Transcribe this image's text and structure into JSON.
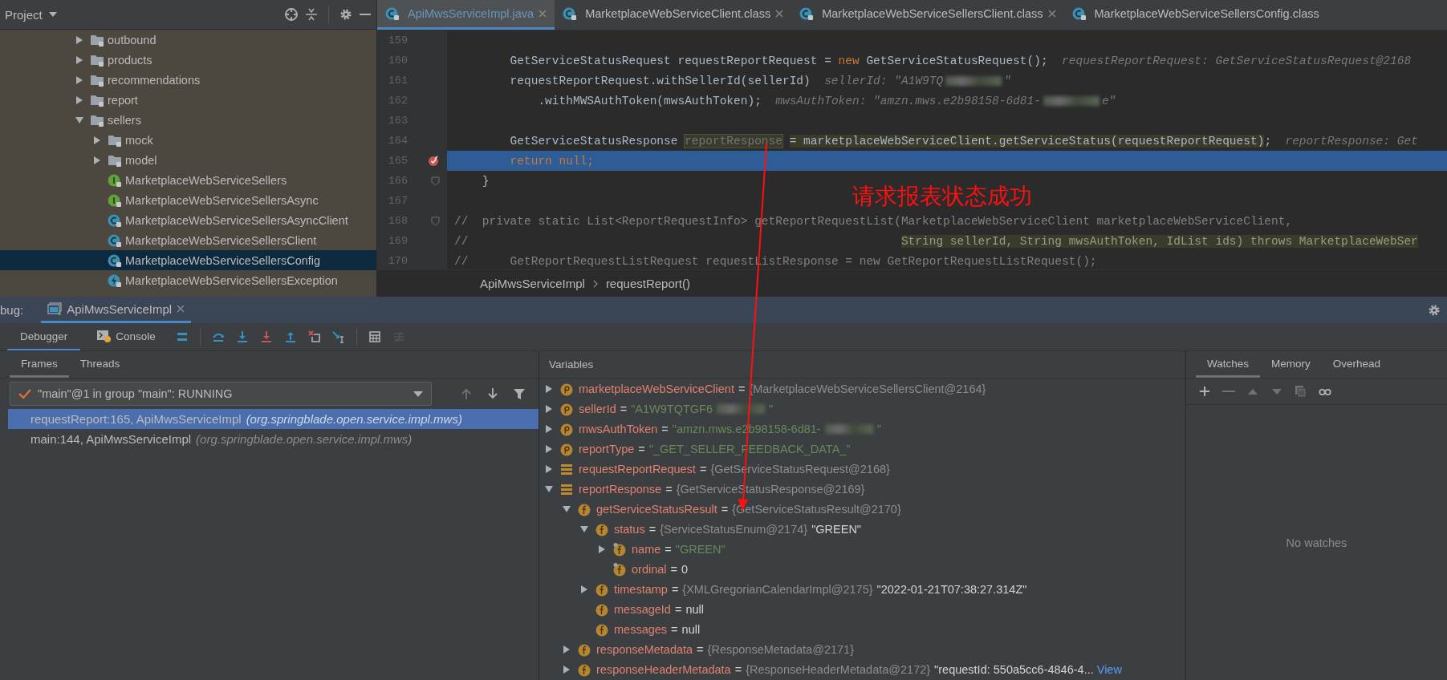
{
  "project": {
    "title": "Project",
    "tree": [
      {
        "label": "outbound",
        "kind": "folder",
        "expanded": false,
        "selected": false
      },
      {
        "label": "products",
        "kind": "folder",
        "expanded": false,
        "selected": false
      },
      {
        "label": "recommendations",
        "kind": "folder",
        "expanded": false,
        "selected": false
      },
      {
        "label": "report",
        "kind": "folder",
        "expanded": false,
        "selected": false
      },
      {
        "label": "sellers",
        "kind": "folder",
        "expanded": true,
        "selected": false,
        "children": [
          {
            "label": "mock",
            "kind": "folder",
            "expanded": false,
            "selected": false
          },
          {
            "label": "model",
            "kind": "folder",
            "expanded": false,
            "selected": false
          },
          {
            "label": "MarketplaceWebServiceSellers",
            "kind": "interface",
            "selected": false
          },
          {
            "label": "MarketplaceWebServiceSellersAsync",
            "kind": "interface",
            "selected": false
          },
          {
            "label": "MarketplaceWebServiceSellersAsyncClient",
            "kind": "class",
            "selected": false
          },
          {
            "label": "MarketplaceWebServiceSellersClient",
            "kind": "class",
            "selected": false
          },
          {
            "label": "MarketplaceWebServiceSellersConfig",
            "kind": "class",
            "selected": true
          },
          {
            "label": "MarketplaceWebServiceSellersException",
            "kind": "exception",
            "selected": false
          }
        ]
      }
    ]
  },
  "editor": {
    "tabs": [
      {
        "label": "ApiMwsServiceImpl.java",
        "selected": true,
        "closable": true
      },
      {
        "label": "MarketplaceWebServiceClient.class",
        "selected": false,
        "closable": true
      },
      {
        "label": "MarketplaceWebServiceSellersClient.class",
        "selected": false,
        "closable": true
      },
      {
        "label": "MarketplaceWebServiceSellersConfig.class",
        "selected": false,
        "closable": false
      }
    ],
    "lines": [
      {
        "number": "159",
        "current": false,
        "breakpoint": false,
        "fold": false
      },
      {
        "number": "160",
        "current": false,
        "breakpoint": false,
        "fold": false,
        "segments": [
          {
            "kind": "plain",
            "text": "        GetServiceStatusRequest requestReportRequest = "
          },
          {
            "kind": "keyword",
            "text": "new"
          },
          {
            "kind": "plain",
            "text": " GetServiceStatusRequest();"
          },
          {
            "kind": "hint",
            "text": "requestReportRequest: GetServiceStatusRequest@2168"
          }
        ]
      },
      {
        "number": "161",
        "current": false,
        "breakpoint": false,
        "fold": false,
        "segments": [
          {
            "kind": "plain",
            "text": "        requestReportRequest.withSellerId(sellerId)"
          },
          {
            "kind": "hint",
            "text": "sellerId: \"A1W9TQ"
          },
          {
            "kind": "redacted"
          },
          {
            "kind": "hint",
            "text": "\""
          }
        ]
      },
      {
        "number": "162",
        "current": false,
        "breakpoint": false,
        "fold": false,
        "segments": [
          {
            "kind": "plain",
            "text": "            .withMWSAuthToken(mwsAuthToken);"
          },
          {
            "kind": "hint",
            "text": "mwsAuthToken: \"amzn.mws.e2b98158-6d81-"
          },
          {
            "kind": "redacted"
          },
          {
            "kind": "hint",
            "text": "e\""
          }
        ]
      },
      {
        "number": "163",
        "current": false,
        "breakpoint": false,
        "fold": false
      },
      {
        "number": "164",
        "current": false,
        "breakpoint": false,
        "fold": false,
        "segments": [
          {
            "kind": "plain",
            "text": "        GetServiceStatusResponse "
          },
          {
            "kind": "unused",
            "text": "reportResponse"
          },
          {
            "kind": "match",
            "text": "= marketplaceWebServiceClient.getServiceStatus(requestReportRequest)"
          },
          {
            "kind": "plain",
            "text": ";"
          },
          {
            "kind": "hint",
            "text": "reportResponse: Get"
          }
        ]
      },
      {
        "number": "165",
        "current": true,
        "breakpoint": true,
        "fold": false,
        "segments": [
          {
            "kind": "keyword",
            "text": "        return null;"
          }
        ]
      },
      {
        "number": "166",
        "current": false,
        "breakpoint": false,
        "fold": true,
        "segments": [
          {
            "kind": "plain",
            "text": "    }"
          }
        ]
      },
      {
        "number": "167",
        "current": false,
        "breakpoint": false,
        "fold": false
      },
      {
        "number": "168",
        "current": false,
        "breakpoint": false,
        "fold": true,
        "segments": [
          {
            "kind": "comment",
            "text": "//  private static List<ReportRequestInfo> getReportRequestList(MarketplaceWebServiceClient marketplaceWebServiceClient,"
          }
        ]
      },
      {
        "number": "169",
        "current": false,
        "breakpoint": false,
        "fold": false,
        "segments": [
          {
            "kind": "comment",
            "text": "//                                                              "
          },
          {
            "kind": "comment-match",
            "text": "String sellerId, String mwsAuthToken, IdList ids) throws MarketplaceWebSer"
          }
        ]
      },
      {
        "number": "170",
        "current": false,
        "breakpoint": false,
        "fold": false,
        "segments": [
          {
            "kind": "comment",
            "text": "//      GetReportRequestListRequest requestListResponse = new GetReportRequestListRequest();"
          }
        ]
      }
    ],
    "breadcrumb": [
      "ApiMwsServiceImpl",
      "requestReport()"
    ]
  },
  "debug": {
    "label": "bug:",
    "tabs": [
      {
        "label": "ApiMwsServiceImpl",
        "selected": true
      }
    ],
    "subtabs": [
      {
        "label": "Debugger",
        "selected": true
      },
      {
        "label": "Console",
        "selected": false
      }
    ],
    "actions": [
      {
        "kind": "show-execution-point",
        "disabled": false
      },
      {
        "kind": "step-over",
        "disabled": false
      },
      {
        "kind": "step-into",
        "disabled": false
      },
      {
        "kind": "force-step-into",
        "disabled": false
      },
      {
        "kind": "step-out",
        "disabled": false
      },
      {
        "kind": "drop-frame",
        "disabled": false
      },
      {
        "kind": "run-to-cursor",
        "disabled": false
      },
      {
        "kind": "evaluate",
        "disabled": false
      },
      {
        "kind": "trace",
        "disabled": true
      }
    ]
  },
  "frames": {
    "tabs": [
      {
        "label": "Frames",
        "selected": true
      },
      {
        "label": "Threads",
        "selected": false
      }
    ],
    "thread": "\"main\"@1 in group \"main\": RUNNING",
    "nav": [
      {
        "kind": "up",
        "disabled": true
      },
      {
        "kind": "down",
        "disabled": false
      },
      {
        "kind": "filter",
        "disabled": false
      }
    ],
    "items": [
      {
        "method": "requestReport:165, ApiMwsServiceImpl",
        "package": "(org.springblade.open.service.impl.mws)",
        "selected": true
      },
      {
        "method": "main:144, ApiMwsServiceImpl",
        "package": "(org.springblade.open.service.impl.mws)",
        "selected": false
      }
    ]
  },
  "variables": {
    "title": "Variables",
    "rows": [
      {
        "name": "marketplaceWebServiceClient",
        "kind": "parameter",
        "expanded": false,
        "value": [
          {
            "kind": "op",
            "text": "="
          },
          {
            "kind": "type",
            "text": "{MarketplaceWebServiceSellersClient@2164}"
          }
        ]
      },
      {
        "name": "sellerId",
        "kind": "parameter",
        "expanded": false,
        "value": [
          {
            "kind": "op",
            "text": "="
          },
          {
            "kind": "string",
            "text": "\"A1W9TQTGF6"
          },
          {
            "kind": "redacted"
          },
          {
            "kind": "string",
            "text": "\""
          }
        ]
      },
      {
        "name": "mwsAuthToken",
        "kind": "parameter",
        "expanded": false,
        "value": [
          {
            "kind": "op",
            "text": "="
          },
          {
            "kind": "string",
            "text": "\"amzn.mws.e2b98158-6d81-"
          },
          {
            "kind": "redacted"
          },
          {
            "kind": "string",
            "text": "\""
          }
        ]
      },
      {
        "name": "reportType",
        "kind": "parameter",
        "expanded": false,
        "value": [
          {
            "kind": "op",
            "text": "="
          },
          {
            "kind": "string",
            "text": "\"_GET_SELLER_FEEDBACK_DATA_\""
          }
        ]
      },
      {
        "name": "requestReportRequest",
        "kind": "object",
        "expanded": false,
        "value": [
          {
            "kind": "op",
            "text": "="
          },
          {
            "kind": "type",
            "text": "{GetServiceStatusRequest@2168}"
          }
        ]
      },
      {
        "name": "reportResponse",
        "kind": "object",
        "expanded": true,
        "value": [
          {
            "kind": "op",
            "text": "="
          },
          {
            "kind": "type",
            "text": "{GetServiceStatusResponse@2169}"
          }
        ],
        "children": [
          {
            "name": "getServiceStatusResult",
            "kind": "field",
            "expanded": true,
            "value": [
              {
                "kind": "op",
                "text": "="
              },
              {
                "kind": "type",
                "text": "{GetServiceStatusResult@2170}"
              }
            ],
            "children": [
              {
                "name": "status",
                "kind": "field",
                "expanded": true,
                "value": [
                  {
                    "kind": "op",
                    "text": "="
                  },
                  {
                    "kind": "type",
                    "text": "{ServiceStatusEnum@2174}"
                  },
                  {
                    "kind": "plain",
                    "text": "\"GREEN\""
                  }
                ],
                "children": [
                  {
                    "name": "name",
                    "kind": "final-field",
                    "expanded": false,
                    "value": [
                      {
                        "kind": "op",
                        "text": "="
                      },
                      {
                        "kind": "string",
                        "text": "\"GREEN\""
                      }
                    ]
                  },
                  {
                    "name": "ordinal",
                    "kind": "final-field",
                    "value": [
                      {
                        "kind": "op",
                        "text": "="
                      },
                      {
                        "kind": "plain",
                        "text": "0"
                      }
                    ]
                  }
                ]
              },
              {
                "name": "timestamp",
                "kind": "field",
                "expanded": false,
                "value": [
                  {
                    "kind": "op",
                    "text": "="
                  },
                  {
                    "kind": "type",
                    "text": "{XMLGregorianCalendarImpl@2175}"
                  },
                  {
                    "kind": "plain",
                    "text": "\"2022-01-21T07:38:27.314Z\""
                  }
                ]
              },
              {
                "name": "messageId",
                "kind": "field",
                "value": [
                  {
                    "kind": "op",
                    "text": "="
                  },
                  {
                    "kind": "plain",
                    "text": "null"
                  }
                ]
              },
              {
                "name": "messages",
                "kind": "field",
                "value": [
                  {
                    "kind": "op",
                    "text": "="
                  },
                  {
                    "kind": "plain",
                    "text": "null"
                  }
                ]
              }
            ]
          },
          {
            "name": "responseMetadata",
            "kind": "field",
            "expanded": false,
            "value": [
              {
                "kind": "op",
                "text": "="
              },
              {
                "kind": "type",
                "text": "{ResponseMetadata@2171}"
              }
            ]
          },
          {
            "name": "responseHeaderMetadata",
            "kind": "field",
            "expanded": false,
            "value": [
              {
                "kind": "op",
                "text": "="
              },
              {
                "kind": "type",
                "text": "{ResponseHeaderMetadata@2172}"
              },
              {
                "kind": "plain",
                "text": "\"requestId: 550a5cc6-4846-4..."
              },
              {
                "kind": "link",
                "text": "View"
              }
            ]
          }
        ]
      }
    ]
  },
  "watches": {
    "tabs": [
      {
        "label": "Watches",
        "selected": true
      },
      {
        "label": "Memory",
        "selected": false
      },
      {
        "label": "Overhead",
        "selected": false
      }
    ],
    "actions": [
      {
        "kind": "add",
        "disabled": false
      },
      {
        "kind": "remove",
        "disabled": true
      },
      {
        "kind": "move-up",
        "disabled": true
      },
      {
        "kind": "move-down",
        "disabled": true
      },
      {
        "kind": "copy",
        "disabled": true
      },
      {
        "kind": "inline-watches",
        "disabled": false
      }
    ],
    "empty_text": "No watches"
  },
  "annotation": {
    "text": "请求报表状态成功"
  }
}
